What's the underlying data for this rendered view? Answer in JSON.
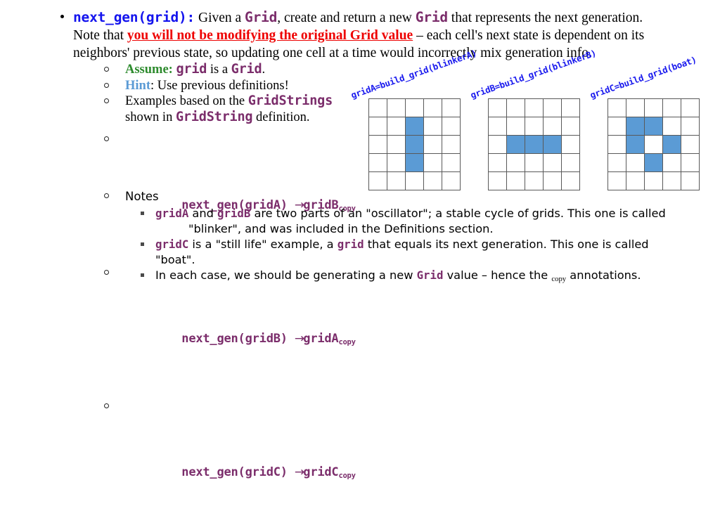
{
  "slide": {
    "main_bullet": {
      "signature": "next_gen(grid):",
      "text_1": " Given a ",
      "code_grid_1": "Grid",
      "text_2": ", create and return a new ",
      "code_grid_2": "Grid",
      "text_3": " that represents the next generation. Note that ",
      "warning": "you will not be modifying the original Grid value",
      "text_4": " – each cell's next state is dependent on its neighbors' previous state, so updating one cell at a time would incorrectly mix generation info."
    },
    "sub_items": {
      "assume_label": "Assume:",
      "assume_code": "grid",
      "assume_mid": " is a ",
      "assume_type": "Grid",
      "assume_end": ".",
      "hint_label": "Hint",
      "hint_text": ": Use previous definitions!",
      "examples_text_1": "Examples based on the ",
      "examples_code_1": "GridStrings",
      "examples_text_2": "shown in ",
      "examples_code_2": "GridString",
      "examples_text_3": " definition."
    },
    "mappings": [
      {
        "call": "next_gen(gridA)",
        "arrow": "→",
        "result": "gridB",
        "sub": "copy"
      },
      {
        "call": "next_gen(gridB)",
        "arrow": "→",
        "result": "gridA",
        "sub": "copy"
      },
      {
        "call": "next_gen(gridC)",
        "arrow": "→",
        "result": "gridC",
        "sub": "copy"
      }
    ],
    "notes": {
      "heading": "Notes",
      "items": [
        {
          "parts": [
            {
              "t": "code",
              "v": "gridA"
            },
            {
              "t": "text",
              "v": " and "
            },
            {
              "t": "code",
              "v": "gridB"
            },
            {
              "t": "text",
              "v": " are two parts of an \"oscillator\"; a stable cycle of grids. This one is called"
            }
          ],
          "continuation": "\"blinker\", and was included in the Definitions section."
        },
        {
          "parts": [
            {
              "t": "code",
              "v": "gridC"
            },
            {
              "t": "text",
              "v": " is a \"still life\" example, a "
            },
            {
              "t": "code",
              "v": "grid"
            },
            {
              "t": "text",
              "v": " that equals its next generation. This one is called \"boat\"."
            }
          ],
          "continuation": ""
        },
        {
          "parts": [
            {
              "t": "text",
              "v": "In each case, we should be generating a new "
            },
            {
              "t": "code",
              "v": "Grid"
            },
            {
              "t": "text",
              "v": " value – hence the "
            },
            {
              "t": "sub",
              "v": "copy"
            },
            {
              "t": "text",
              "v": " annotations."
            }
          ],
          "continuation": ""
        }
      ]
    }
  },
  "figures": [
    {
      "id": "gridA",
      "label": "gridA=build_grid(blinkerA)",
      "rows": 5,
      "cols": 5,
      "live_cells": [
        [
          1,
          2
        ],
        [
          2,
          2
        ],
        [
          3,
          2
        ]
      ]
    },
    {
      "id": "gridB",
      "label": "gridB=build_grid(blinkerB)",
      "rows": 5,
      "cols": 5,
      "live_cells": [
        [
          2,
          1
        ],
        [
          2,
          2
        ],
        [
          2,
          3
        ]
      ]
    },
    {
      "id": "gridC",
      "label": "gridC=build_grid(boat)",
      "rows": 5,
      "cols": 5,
      "live_cells": [
        [
          1,
          1
        ],
        [
          1,
          2
        ],
        [
          2,
          1
        ],
        [
          2,
          3
        ],
        [
          3,
          2
        ]
      ]
    }
  ],
  "colors": {
    "code_purple": "#7b2d6b",
    "signature_blue": "#1414ee",
    "warning_red": "#ee0000",
    "assume_green": "#2e8b2e",
    "hint_blue": "#5b9bd5",
    "cell_fill": "#5b9bd5",
    "grid_line": "#595959",
    "label_blue": "#1a1aee"
  }
}
